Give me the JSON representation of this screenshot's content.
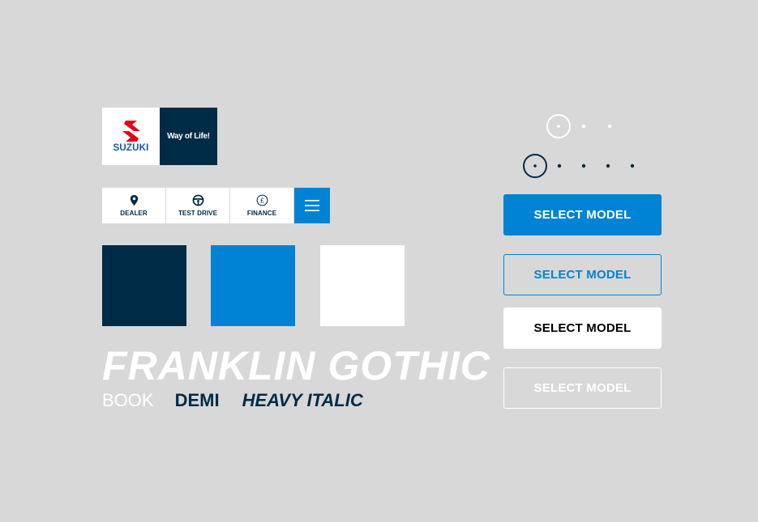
{
  "logo": {
    "brand": "SUZUKI",
    "tagline": "Way of Life!",
    "mark_icon": "suzuki-s-mark",
    "brand_color": "#1a56a8",
    "mark_color": "#e30613"
  },
  "nav": {
    "items": [
      {
        "label": "DEALER",
        "icon": "map-pin-icon"
      },
      {
        "label": "TEST DRIVE",
        "icon": "steering-wheel-icon"
      },
      {
        "label": "FINANCE",
        "icon": "pound-icon"
      }
    ],
    "menu_icon": "hamburger-menu-icon"
  },
  "palette": {
    "navy": "#002b46",
    "blue": "#0083d4",
    "white": "#ffffff"
  },
  "typography": {
    "family_title": "FRANKLIN GOTHIC",
    "weights": [
      "BOOK",
      "DEMI",
      "HEAVY ITALIC"
    ]
  },
  "pagination": {
    "light": {
      "total": 3,
      "active": 1
    },
    "dark": {
      "total": 5,
      "active": 1
    }
  },
  "buttons": {
    "primary": "SELECT MODEL",
    "outline": "SELECT MODEL",
    "white": "SELECT MODEL",
    "ghost": "SELECT MODEL"
  }
}
